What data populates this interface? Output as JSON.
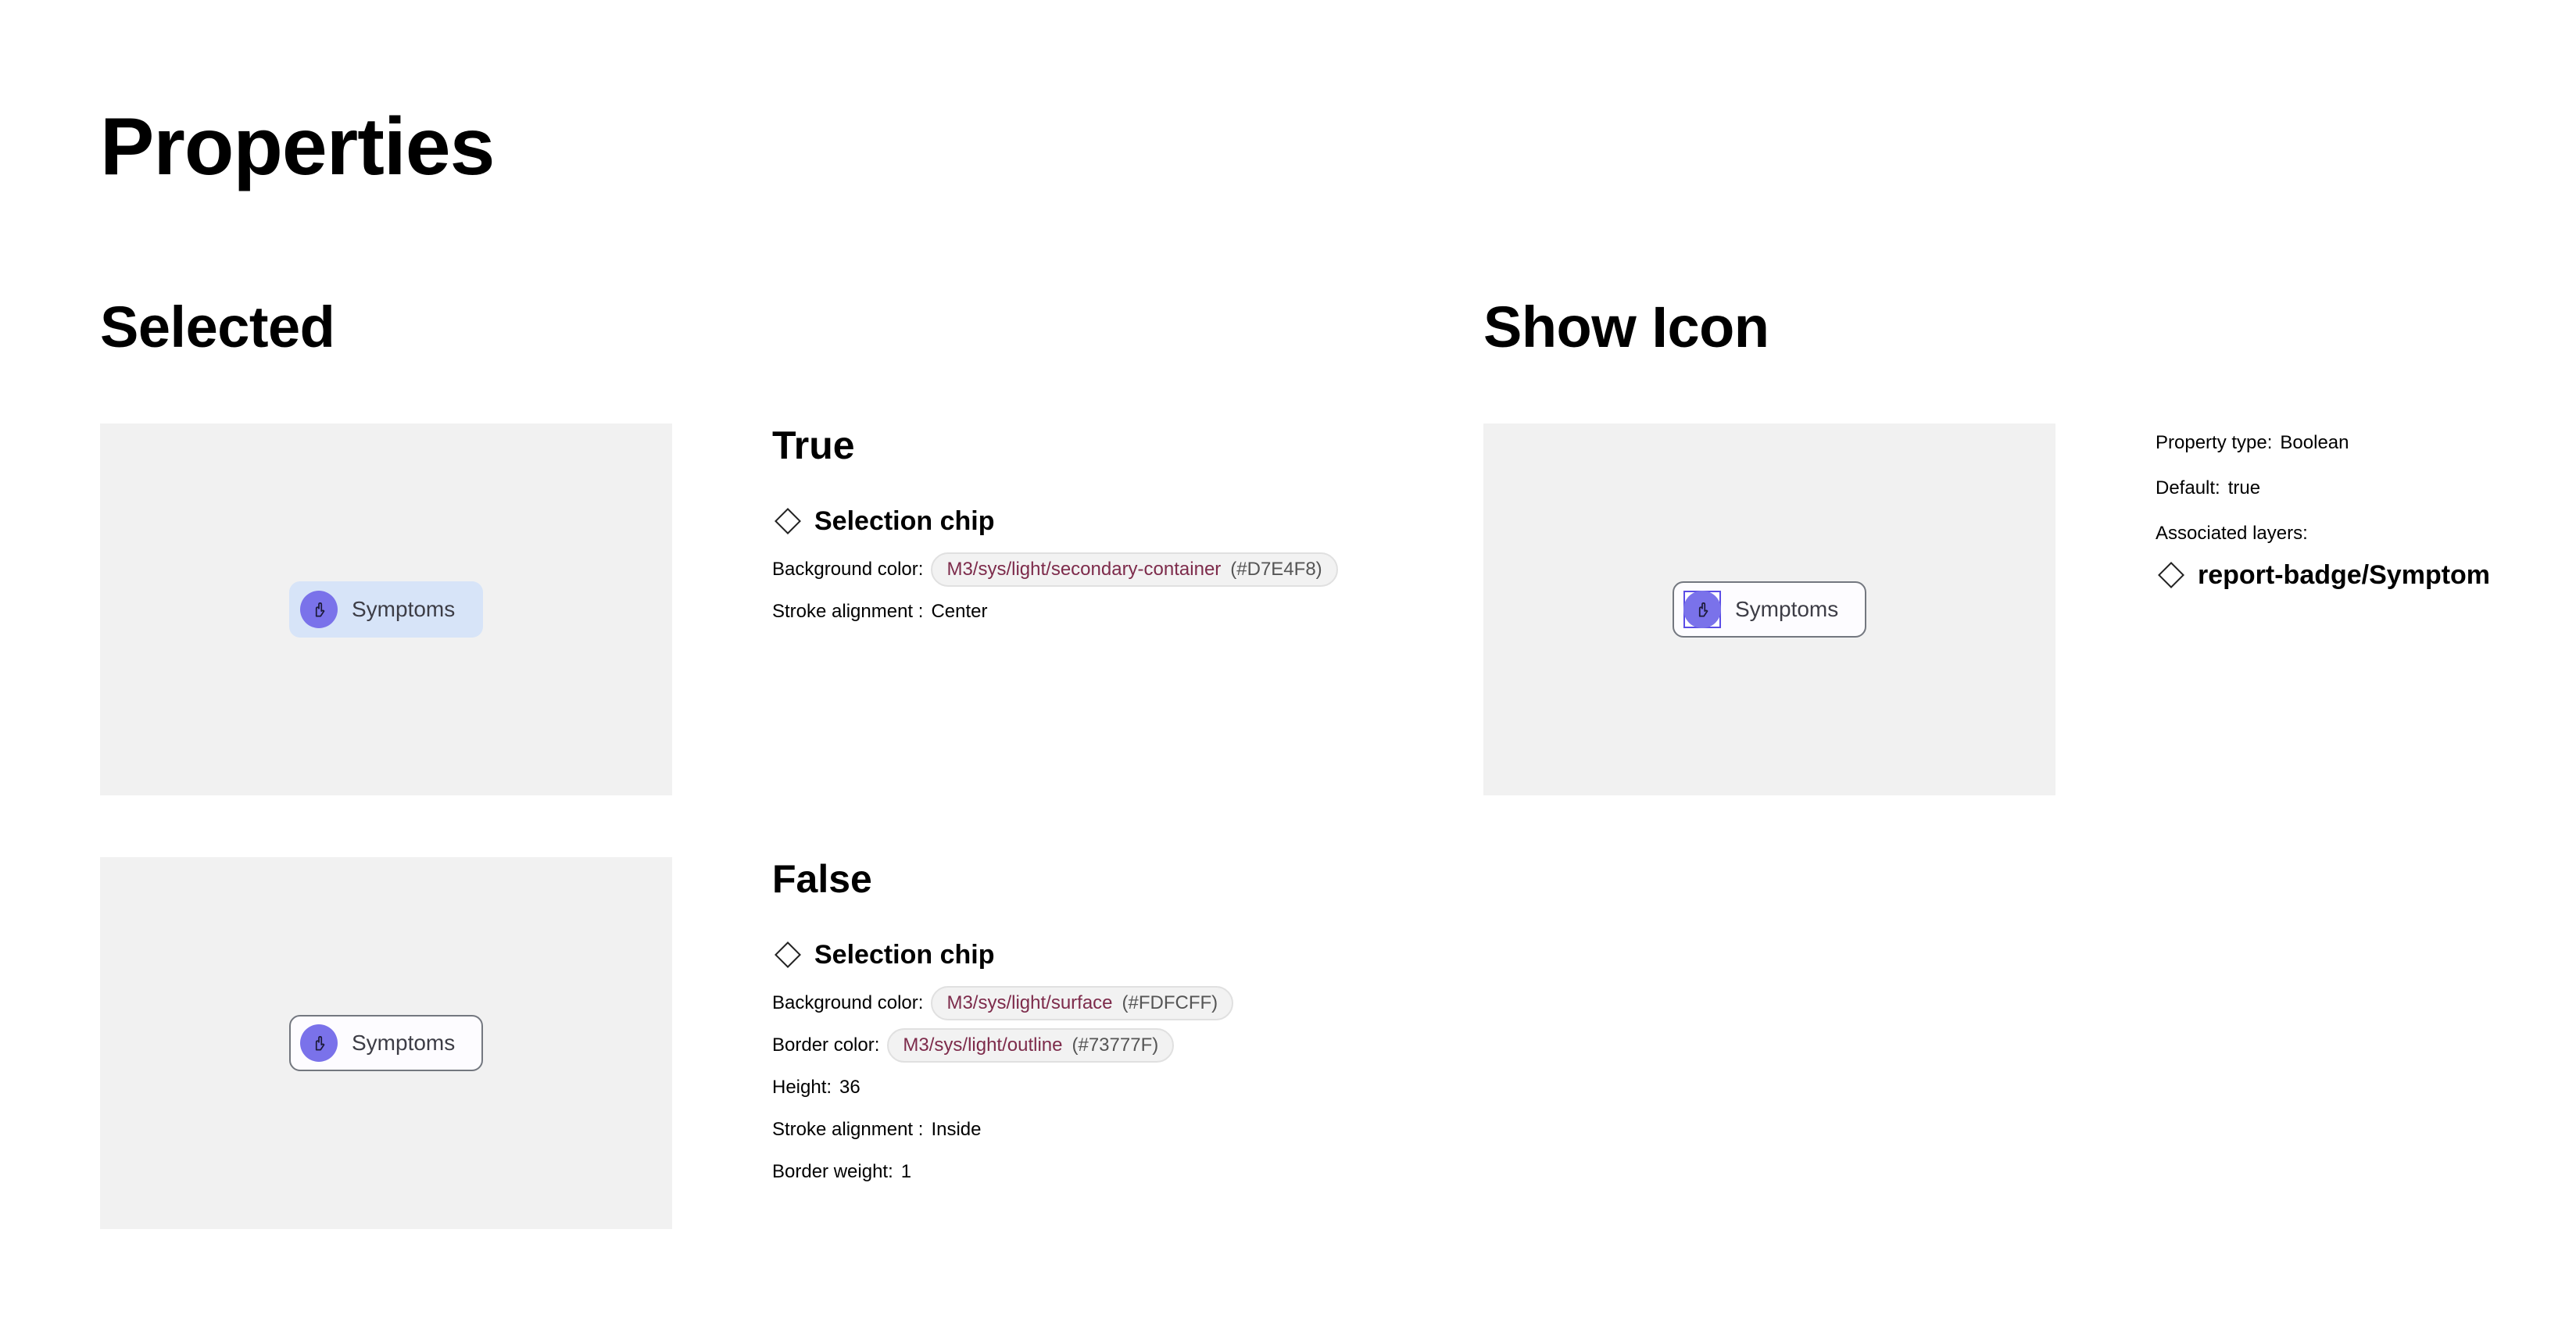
{
  "page_title": "Properties",
  "selected": {
    "title": "Selected",
    "chip_label": "Symptoms",
    "true_variant": {
      "title": "True",
      "component": "Selection chip",
      "props": {
        "background_label": "Background color:",
        "background_token": "M3/sys/light/secondary-container",
        "background_hex": "(#D7E4F8)",
        "stroke_label": "Stroke alignment :",
        "stroke_value": "Center"
      }
    },
    "false_variant": {
      "title": "False",
      "component": "Selection chip",
      "props": {
        "background_label": "Background color:",
        "background_token": "M3/sys/light/surface",
        "background_hex": "(#FDFCFF)",
        "border_label": "Border color:",
        "border_token": "M3/sys/light/outline",
        "border_hex": "(#73777F)",
        "height_label": "Height:",
        "height_value": "36",
        "stroke_label": "Stroke alignment :",
        "stroke_value": "Inside",
        "weight_label": "Border weight:",
        "weight_value": "1"
      }
    }
  },
  "show_icon": {
    "title": "Show Icon",
    "chip_label": "Symptoms",
    "property_type_label": "Property type:",
    "property_type_value": "Boolean",
    "default_label": "Default:",
    "default_value": "true",
    "associated_label": "Associated layers:",
    "associated_layer": "report-badge/Symptom"
  },
  "icons": {
    "chip_icon": "hand-symptom-icon",
    "component_icon": "component-diamond-icon"
  },
  "colors": {
    "secondary_container": "#D7E4F8",
    "surface": "#FDFCFF",
    "outline": "#73777F",
    "icon_fill": "#7A72EA",
    "token_text": "#7D2B4B",
    "preview_bg": "#F1F1F1"
  }
}
